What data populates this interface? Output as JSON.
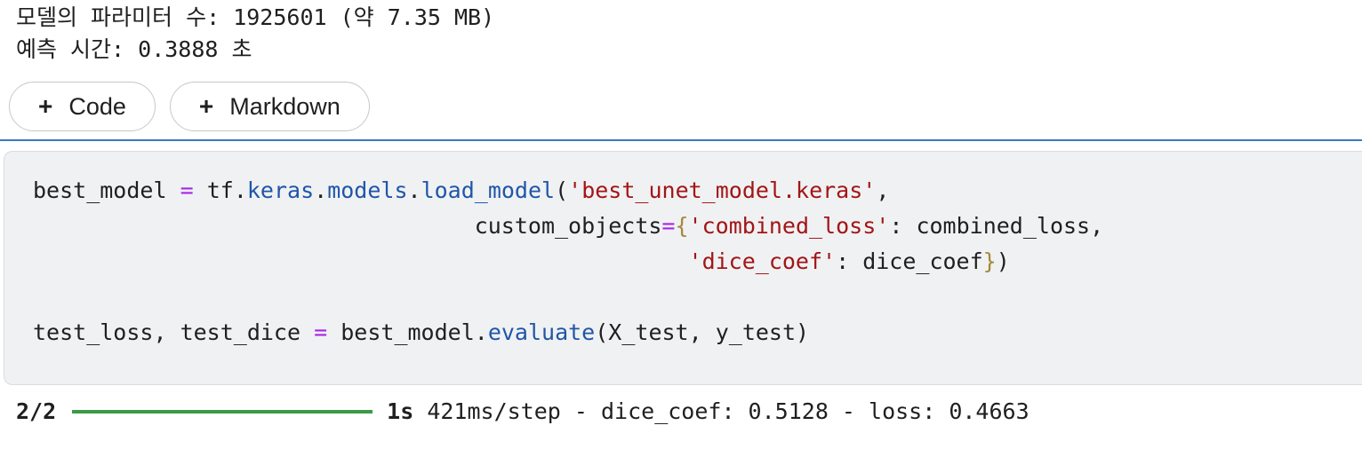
{
  "previous_output": {
    "line1": "모델의 파라미터 수: 1925601 (약 7.35 MB)",
    "line2": "예측 시간: 0.3888 초"
  },
  "toolbar": {
    "code_button_label": "Code",
    "markdown_button_label": "Markdown",
    "plus_glyph": "+"
  },
  "code_cell": {
    "tokens": {
      "best_model": "best_model",
      "eq": "=",
      "tf": "tf",
      "keras": "keras",
      "models": "models",
      "load_model": "load_model",
      "model_file": "'best_unet_model.keras'",
      "custom_objects": "custom_objects",
      "combined_loss_key": "'combined_loss'",
      "combined_loss": "combined_loss",
      "dice_coef_key": "'dice_coef'",
      "dice_coef": "dice_coef",
      "test_loss": "test_loss",
      "test_dice": "test_dice",
      "evaluate": "evaluate",
      "X_test": "X_test",
      "y_test": "y_test"
    }
  },
  "cell_output": {
    "step": "2/2",
    "progress": 1.0,
    "time": "1s",
    "metrics": "421ms/step - dice_coef: 0.5128 - loss: 0.4663"
  },
  "colors": {
    "operator": "#a626e8",
    "attribute": "#1f56a8",
    "string": "#a31515",
    "progress_bar": "#3a9a48",
    "divider": "#3b78c4"
  }
}
